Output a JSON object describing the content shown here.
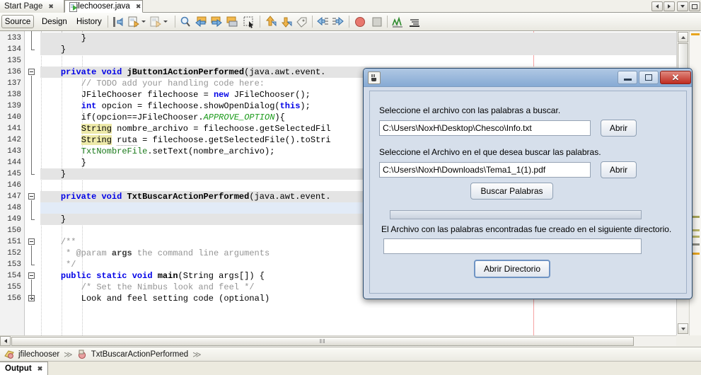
{
  "window": {
    "tabs": [
      {
        "label": "Start Page",
        "active": false,
        "icon": "none",
        "close": "✖"
      },
      {
        "label": "jfilechooser.java",
        "active": true,
        "icon": "java-file-icon",
        "close": "✖"
      }
    ],
    "nav_buttons": [
      "back-icon",
      "forward-icon",
      "dropdown-icon",
      "maximize-icon"
    ]
  },
  "toolbar": {
    "modes": [
      {
        "label": "Source",
        "selected": true
      },
      {
        "label": "Design",
        "selected": false
      },
      {
        "label": "History",
        "selected": false
      }
    ],
    "icons": [
      "shift-lines-left-icon",
      "comment-icon",
      "uncomment-icon",
      "find-icon",
      "previous-bookmark-icon",
      "next-bookmark-icon",
      "toggle-bookmark-icon",
      "rectangular-selection-icon",
      "shift-up-icon",
      "shift-down-icon",
      "toggle-highlight-icon",
      "shift-left-icon",
      "shift-right-icon",
      "record-macro-icon",
      "stop-macro-icon",
      "inspect-icon",
      "diff-icon"
    ]
  },
  "editor": {
    "first_line": 133,
    "right_margin_column_line": true,
    "lines": [
      {
        "n": 133,
        "indent": 8,
        "highlight": "gray",
        "tokens": [
          {
            "t": "}",
            "c": "pl"
          }
        ]
      },
      {
        "n": 134,
        "indent": 4,
        "highlight": "gray",
        "tokens": [
          {
            "t": "}",
            "c": "pl"
          }
        ]
      },
      {
        "n": 135,
        "indent": 0,
        "highlight": "none",
        "tokens": []
      },
      {
        "n": 136,
        "indent": 4,
        "highlight": "gray",
        "tokens": [
          {
            "t": "private ",
            "c": "kw"
          },
          {
            "t": "void ",
            "c": "kw"
          },
          {
            "t": "jButton1ActionPerformed",
            "c": "bold"
          },
          {
            "t": "(java.awt.event.",
            "c": "pl"
          }
        ]
      },
      {
        "n": 137,
        "indent": 8,
        "highlight": "none",
        "tokens": [
          {
            "t": "// TODO add your handling code here:",
            "c": "cm"
          }
        ]
      },
      {
        "n": 138,
        "indent": 8,
        "highlight": "none",
        "tokens": [
          {
            "t": "JFileChooser filechoose = ",
            "c": "pl"
          },
          {
            "t": "new ",
            "c": "kw"
          },
          {
            "t": "JFileChooser();",
            "c": "pl"
          }
        ]
      },
      {
        "n": 139,
        "indent": 8,
        "highlight": "none",
        "tokens": [
          {
            "t": "int ",
            "c": "kw"
          },
          {
            "t": "opcion = filechoose.showOpenDialog(",
            "c": "pl"
          },
          {
            "t": "this",
            "c": "kw"
          },
          {
            "t": ");",
            "c": "pl"
          }
        ]
      },
      {
        "n": 140,
        "indent": 8,
        "highlight": "none",
        "tokens": [
          {
            "t": "if(opcion==JFileChooser.",
            "c": "pl"
          },
          {
            "t": "APPROVE_OPTION",
            "c": "cst"
          },
          {
            "t": "){",
            "c": "pl"
          }
        ]
      },
      {
        "n": 141,
        "indent": 8,
        "highlight": "none",
        "tokens": [
          {
            "t": "String",
            "c": "hly"
          },
          {
            "t": " nombre_archivo = filechoose.getSelectedFil",
            "c": "pl"
          }
        ]
      },
      {
        "n": 142,
        "indent": 8,
        "highlight": "none",
        "tokens": [
          {
            "t": "String",
            "c": "hly"
          },
          {
            "t": " ",
            "c": "pl"
          },
          {
            "t": "ruta",
            "c": "wav"
          },
          {
            "t": " = filechoose.getSelectedFile().toStri",
            "c": "pl"
          }
        ]
      },
      {
        "n": 143,
        "indent": 8,
        "highlight": "none",
        "tokens": [
          {
            "t": "TxtNombreFile",
            "c": "fld"
          },
          {
            "t": ".setText(nombre_archivo);",
            "c": "pl"
          }
        ]
      },
      {
        "n": 144,
        "indent": 8,
        "highlight": "none",
        "tokens": [
          {
            "t": "}",
            "c": "pl"
          }
        ]
      },
      {
        "n": 145,
        "indent": 4,
        "highlight": "gray",
        "tokens": [
          {
            "t": "}",
            "c": "pl"
          }
        ]
      },
      {
        "n": 146,
        "indent": 0,
        "highlight": "none",
        "tokens": []
      },
      {
        "n": 147,
        "indent": 4,
        "highlight": "gray",
        "tokens": [
          {
            "t": "private ",
            "c": "kw"
          },
          {
            "t": "void ",
            "c": "kw"
          },
          {
            "t": "TxtBuscarActionPerformed",
            "c": "bold"
          },
          {
            "t": "(java.awt.event.",
            "c": "pl"
          }
        ]
      },
      {
        "n": 148,
        "indent": 0,
        "highlight": "blue",
        "tokens": []
      },
      {
        "n": 149,
        "indent": 4,
        "highlight": "gray",
        "tokens": [
          {
            "t": "}",
            "c": "pl"
          }
        ]
      },
      {
        "n": 150,
        "indent": 0,
        "highlight": "none",
        "tokens": []
      },
      {
        "n": 151,
        "indent": 4,
        "highlight": "none",
        "tokens": [
          {
            "t": "/**",
            "c": "cm"
          }
        ]
      },
      {
        "n": 152,
        "indent": 4,
        "highlight": "none",
        "tokens": [
          {
            "t": " * ",
            "c": "cm"
          },
          {
            "t": "@param ",
            "c": "cm"
          },
          {
            "t": "args",
            "c": "cmb"
          },
          {
            "t": " the command line arguments",
            "c": "cm"
          }
        ]
      },
      {
        "n": 153,
        "indent": 4,
        "highlight": "none",
        "tokens": [
          {
            "t": " */",
            "c": "cm"
          }
        ]
      },
      {
        "n": 154,
        "indent": 4,
        "highlight": "none",
        "tokens": [
          {
            "t": "public ",
            "c": "kw"
          },
          {
            "t": "static ",
            "c": "kw"
          },
          {
            "t": "void ",
            "c": "kw"
          },
          {
            "t": "main",
            "c": "bold"
          },
          {
            "t": "(String args[]) {",
            "c": "pl"
          }
        ]
      },
      {
        "n": 155,
        "indent": 8,
        "highlight": "none",
        "tokens": [
          {
            "t": "/* Set the Nimbus look and feel */",
            "c": "cm"
          }
        ]
      },
      {
        "n": 156,
        "indent": 8,
        "highlight": "none",
        "tokens": [
          {
            "t": "Look and feel setting code (optional)",
            "c": "pl"
          }
        ]
      }
    ],
    "fold_markers": [
      {
        "line": 136,
        "type": "minus"
      },
      {
        "line": 147,
        "type": "minus"
      },
      {
        "line": 151,
        "type": "minus"
      },
      {
        "line": 154,
        "type": "minus"
      },
      {
        "line": 156,
        "type": "plus"
      }
    ],
    "hscroll_grip": "‖‖"
  },
  "dialog": {
    "title": "",
    "window_controls": {
      "minimize": "–",
      "maximize": "□",
      "close": "✕"
    },
    "label1": "Seleccione el archivo con las palabras a buscar.",
    "field1_value": "C:\\Users\\NoxH\\Desktop\\Chesco\\Info.txt",
    "button1_label": "Abrir",
    "label2": "Seleccione el Archivo en el que desea buscar las palabras.",
    "field2_value": "C:\\Users\\NoxH\\Downloads\\Tema1_1(1).pdf",
    "button2_label": "Abrir",
    "search_button_label": "Buscar Palabras",
    "progress_value": "",
    "label3": "El Archivo con las palabras encontradas fue creado en el siguiente directorio.",
    "field3_value": "",
    "open_dir_button_label": "Abrir Directorio"
  },
  "breadcrumb": {
    "items": [
      {
        "label": "jfilechooser",
        "icon": "class-icon"
      },
      {
        "label": "TxtBuscarActionPerformed",
        "icon": "method-icon"
      }
    ],
    "separator": "≫"
  },
  "output": {
    "tab_label": "Output",
    "close": "✖"
  },
  "colors": {
    "keyword": "#0000e6",
    "comment": "#959595",
    "field": "#1a7a1a",
    "constant": "#1a9a1a",
    "highlight_yellow": "#ede9a8",
    "selection_blue": "#e2ebf7",
    "dialog_bg": "#d6dfeb",
    "title_blue": "#86aad4",
    "close_red": "#bf2b20",
    "margin_pink": "#f6a3a3"
  }
}
